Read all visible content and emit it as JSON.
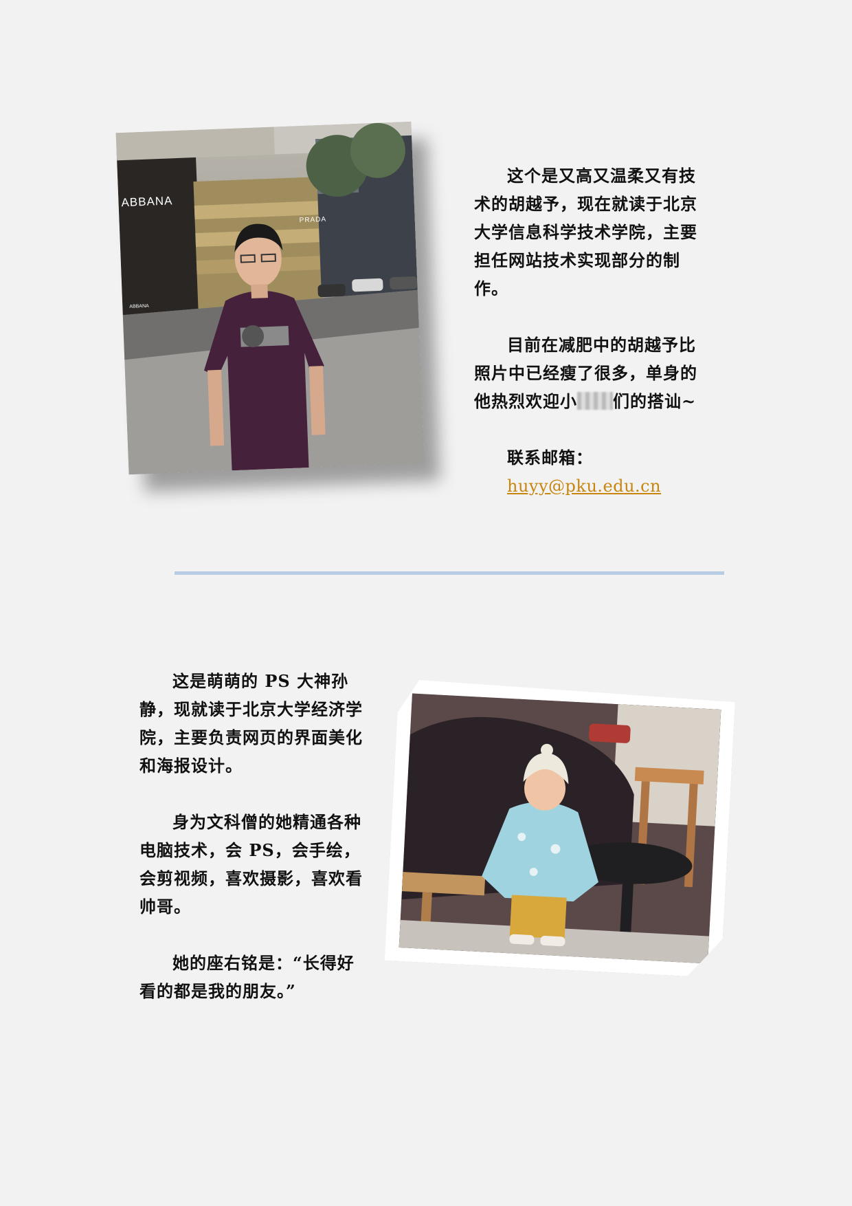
{
  "section1": {
    "paragraph1": "这个是又高又温柔又有技术的胡越予，现在就读于北京大学信息科学技术学院，主要担任网站技术实现部分的制作。",
    "paragraph2_a": "目前在减肥中的胡越予比照片中已经瘦了很多，单身的他热烈欢迎小",
    "paragraph2_b": "们的搭讪~",
    "contact_label": "联系邮箱：",
    "email": "huyy@pku.edu.cn"
  },
  "section2": {
    "paragraph1": "这是萌萌的 PS 大神孙静，现就读于北京大学经济学院，主要负责网页的界面美化和海报设计。",
    "paragraph2": "身为文科僧的她精通各种电脑技术，会 PS，会手绘，会剪视频，喜欢摄影，喜欢看帅哥。",
    "paragraph3": "她的座右铭是：“长得好看的都是我的朋友。”"
  },
  "photo1_signs": [
    "ABBANA",
    "PRADA",
    "ABBANA"
  ],
  "colors": {
    "background": "#f2f2f2",
    "divider": "#b8cde3",
    "email": "#c8860f"
  }
}
